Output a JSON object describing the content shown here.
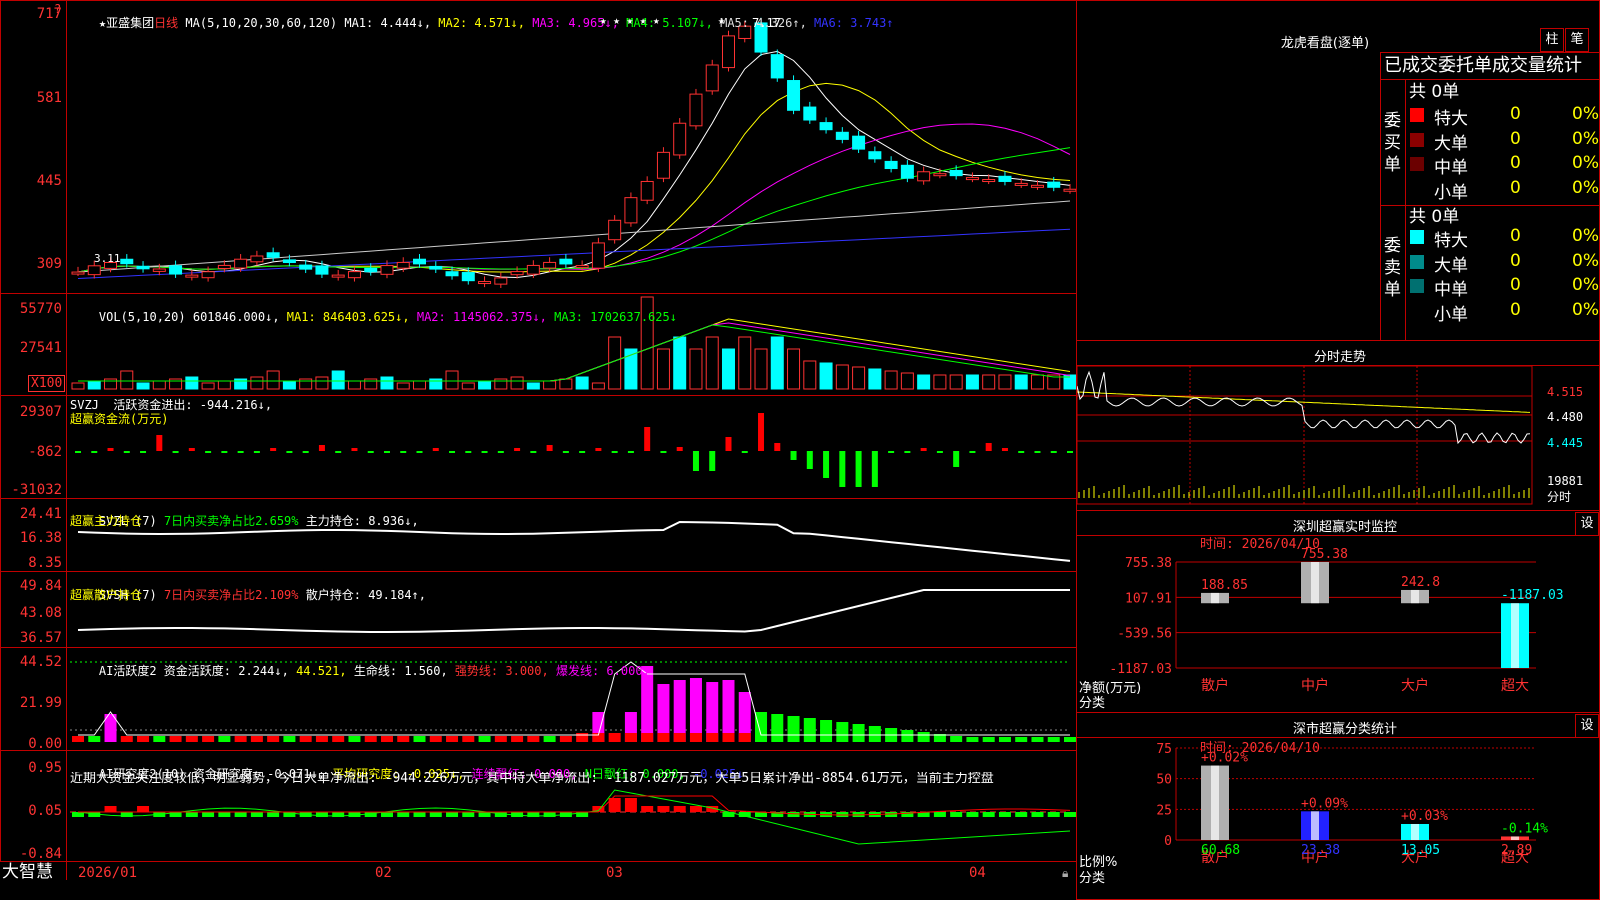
{
  "colors": {
    "up": "#ff3232",
    "down": "#00ffff",
    "buy_big": "#ff0000",
    "sell_big": "#00ffff",
    "green": "#00ff00",
    "magenta": "#ff00ff",
    "yellow": "#ffff00",
    "white": "#ffffff",
    "frame": "#c00000",
    "ma_blue": "#3333ff"
  },
  "price_panel": {
    "header": {
      "star": "★",
      "name": "亚盛集团",
      "period": "日线",
      "ma_spec": "MA(5,10,20,30,60,120)",
      "ma1": "MA1: 4.444↓,",
      "ma2": "MA2: 4.571↓,",
      "ma3": "MA3: 4.965↓,",
      "ma4": "MA4: 5.107↓,",
      "ma5": "MA5: 4.326↑,",
      "ma6": "MA6: 3.743↑"
    },
    "yticks": [
      "717",
      "581",
      "445",
      "309"
    ],
    "stars": "★ ★ ★ ★ ★",
    "star2": "★",
    "max_label": "7.17",
    "min_label": "3.11",
    "chart_data": {
      "type": "candlestick",
      "y_range": [
        3.0,
        7.25
      ],
      "ylabels_price": [
        7.17,
        5.81,
        4.45,
        3.09
      ]
    }
  },
  "vol_panel": {
    "header": "VOL(5,10,20)",
    "vol_val": "601846.000↓,",
    "ma1": "MA1: 846403.625↓,",
    "ma2": "MA2: 1145062.375↓,",
    "ma3": "MA3: 1702637.625↓",
    "yticks": [
      "55770",
      "27541"
    ],
    "unit": "X100"
  },
  "svzj_panel": {
    "header": "SVZJ  活跃资金进出: -944.216↓,",
    "sub": "超赢资金流(万元)",
    "yticks": [
      "29307",
      "-862",
      "-31032"
    ]
  },
  "svzl_panel": {
    "header_a": "SVZL (7)",
    "header_b": "7日内买卖净占比2.659%",
    "header_c": "主力持仓: 8.936↓,",
    "sub": "超赢主力持仓",
    "yticks": [
      "24.41",
      "16.38",
      "8.35"
    ]
  },
  "svsh_panel": {
    "header_a": "SVSH (7)",
    "header_b": "7日内买卖净占比2.109%",
    "header_c": "散户持仓: 49.184↑,",
    "sub": "超赢散户持仓",
    "yticks": [
      "49.84",
      "43.08",
      "36.57"
    ]
  },
  "ai2_panel": {
    "header_a": "AI活跃度2 资金活跃度: 2.244↓,",
    "header_b": "44.521,",
    "header_c": "生命线: 1.560,",
    "header_d": "强势线: 3.000,",
    "header_e": "爆发线: 6.000,",
    "yticks": [
      "44.52",
      "21.99",
      "0.00"
    ]
  },
  "ai_research_panel": {
    "header_a": "AI研究度2(10) 资金研究度: -0.071↓,",
    "header_b": "平均研究度: -0.025↓,",
    "header_c": "连续飘红: 0.000,",
    "header_d": "N日飘红: 0.000,",
    "header_e": "-0.025↓",
    "comment": "近期大资金关注度较低，明显弱势，今日大单净流出: -944.226万元，其中特大单净流出: -1187.027万元，大单5日累计净出-8854.61万元，当前主力控盘",
    "yticks": [
      "0.95",
      "0.05",
      "-0.84"
    ]
  },
  "xaxis": {
    "labels": [
      "2026/01",
      "02",
      "03",
      "04"
    ]
  },
  "brand": "大智慧",
  "longhu": {
    "title": "龙虎看盘(逐单)",
    "tab_zhu": "柱",
    "tab_bi": "笔",
    "subtitle": "已成交委托单成交量统计",
    "buy": {
      "side": "委买单",
      "total": "共 0单",
      "rows": [
        {
          "c": "#ff0000",
          "label": "特大",
          "n": "0",
          "p": "0%"
        },
        {
          "c": "#8b0000",
          "label": "大单",
          "n": "0",
          "p": "0%"
        },
        {
          "c": "#6b0000",
          "label": "中单",
          "n": "0",
          "p": "0%"
        },
        {
          "c": "",
          "label": "小单",
          "n": "0",
          "p": "0%"
        }
      ]
    },
    "sell": {
      "side": "委卖单",
      "total": "共 0单",
      "rows": [
        {
          "c": "#00ffff",
          "label": "特大",
          "n": "0",
          "p": "0%"
        },
        {
          "c": "#008b8b",
          "label": "大单",
          "n": "0",
          "p": "0%"
        },
        {
          "c": "#007070",
          "label": "中单",
          "n": "0",
          "p": "0%"
        },
        {
          "c": "",
          "label": "小单",
          "n": "0",
          "p": "0%"
        }
      ]
    }
  },
  "fenshi": {
    "title": "分时走势",
    "ylabels": [
      "4.515",
      "4.480",
      "4.445"
    ],
    "vol_label": "19881",
    "vol_unit": "分时"
  },
  "monitor": {
    "title": "深圳超赢实时监控",
    "btn": "设",
    "time": "时间: 2026/04/10",
    "yticks": [
      "755.38",
      "107.91",
      "-539.56",
      "-1187.03"
    ],
    "ylabel1": "净额(万元)",
    "ylabel2": "分类",
    "chart_data": {
      "type": "bar",
      "categories": [
        "散户",
        "中户",
        "大户",
        "超大"
      ],
      "values": [
        188.85,
        755.38,
        242.8,
        -1187.03
      ],
      "value_labels": [
        "188.85",
        "755.38",
        "242.8",
        "-1187.03"
      ],
      "ylim": [
        -1187.03,
        755.38
      ]
    }
  },
  "classify": {
    "title": "深市超赢分类统计",
    "btn": "设",
    "time": "时间: 2026/04/10",
    "yticks": [
      "75",
      "50",
      "25",
      "0"
    ],
    "ylabel1": "比例%",
    "ylabel2": "分类",
    "chart_data": {
      "type": "bar",
      "categories": [
        "散户",
        "中户",
        "大户",
        "超大"
      ],
      "values": [
        60.68,
        23.38,
        13.05,
        2.89
      ],
      "changes": [
        "+0.02%",
        "+0.09%",
        "+0.03%",
        "-0.14%"
      ],
      "ylim": [
        0,
        75
      ]
    }
  }
}
